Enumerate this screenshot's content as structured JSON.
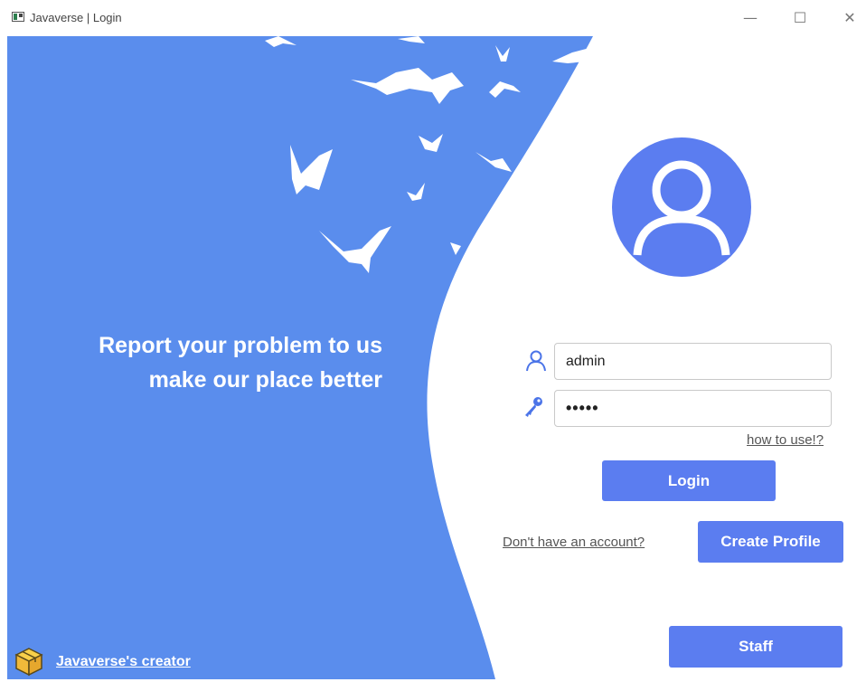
{
  "window": {
    "title": "Javaverse | Login",
    "controls": {
      "minimize": "—",
      "maximize": "☐",
      "close": "✕"
    }
  },
  "hero": {
    "line1": "Report your problem to us",
    "line2": "make our place better"
  },
  "form": {
    "username_value": "admin",
    "password_value": "•••••",
    "help_link": "how to use!?",
    "login_label": "Login",
    "no_account_text": "Don't have an account?",
    "create_label": "Create Profile",
    "staff_label": "Staff"
  },
  "footer": {
    "creator_link": "Javaverse's creator"
  },
  "colors": {
    "accent": "#5b7df0",
    "panel_blue": "#5a8ded",
    "white": "#ffffff"
  },
  "icons": [
    "window-app-icon",
    "bird-flock-icon",
    "user-avatar-icon",
    "user-icon",
    "key-icon",
    "box-icon"
  ]
}
